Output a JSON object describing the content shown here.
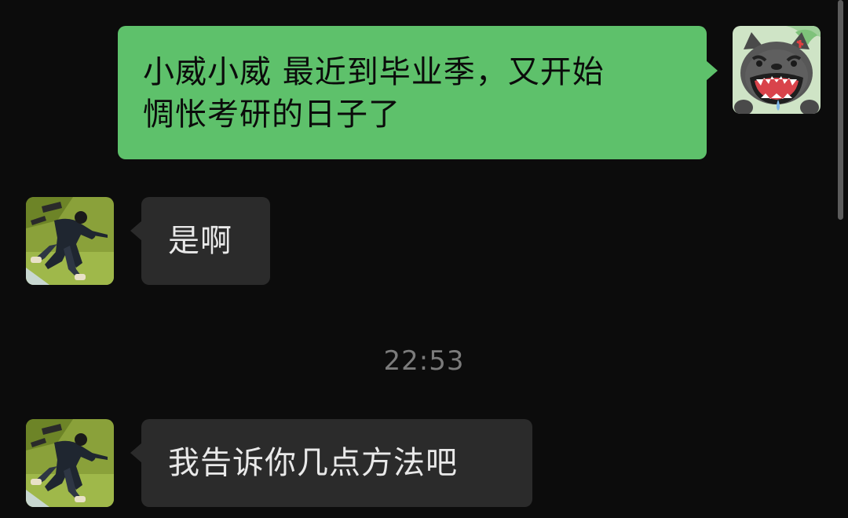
{
  "messages": [
    {
      "side": "right",
      "sender": "self",
      "avatar_icon": "cartoon-dog-avatar-icon",
      "text_line1": "小威小威 最近到毕业季，又开始",
      "text_line2": "惆怅考研的日子了"
    },
    {
      "side": "left",
      "sender": "contact",
      "avatar_icon": "person-lying-avatar-icon",
      "text": "是啊"
    },
    {
      "side": "left",
      "sender": "contact",
      "avatar_icon": "person-lying-avatar-icon",
      "text": "我告诉你几点方法吧"
    }
  ],
  "timestamp": "22:53",
  "colors": {
    "background": "#0c0c0c",
    "outgoing_bubble": "#5ec16b",
    "incoming_bubble": "#2b2b2b",
    "timestamp_text": "#7b7b7b"
  }
}
